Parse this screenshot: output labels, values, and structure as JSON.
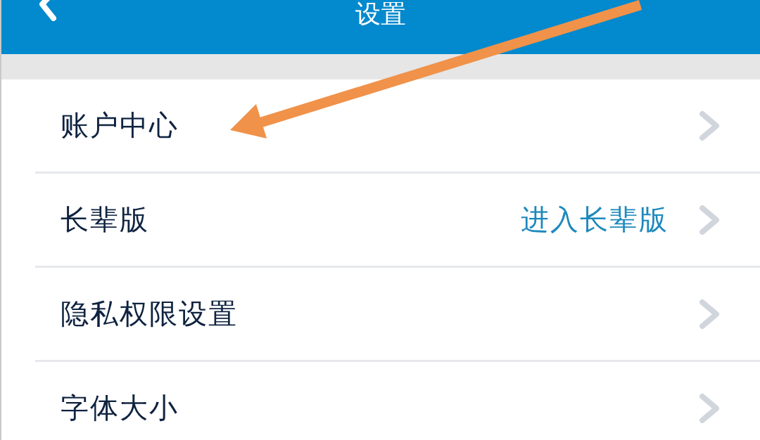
{
  "header": {
    "title": "设置"
  },
  "settings_rows": [
    {
      "label": "账户中心"
    },
    {
      "label": "长辈版",
      "value": "进入长辈版"
    },
    {
      "label": "隐私权限设置"
    },
    {
      "label": "字体大小"
    }
  ]
}
